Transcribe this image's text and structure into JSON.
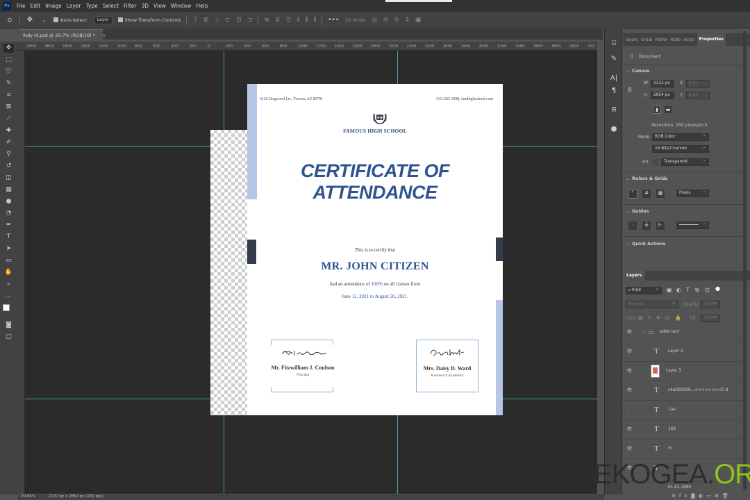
{
  "app": {
    "menu": [
      "File",
      "Edit",
      "Image",
      "Layer",
      "Type",
      "Select",
      "Filter",
      "3D",
      "View",
      "Window",
      "Help"
    ],
    "ps_logo": "Ps"
  },
  "options_bar": {
    "auto_select_label": "Auto-Select:",
    "auto_select_value": "Layer",
    "show_transform_label": "Show Transform Controls",
    "mode_3d_label": "3D Mode:",
    "more": "•••"
  },
  "document_tab": {
    "title": "Italy id.psd @ 20.7% (RGB/16) *",
    "close": "×"
  },
  "ruler": {
    "top_ticks": [
      "2000",
      "1800",
      "1600",
      "1400",
      "1200",
      "1000",
      "800",
      "600",
      "400",
      "200",
      "0",
      "200",
      "400",
      "600",
      "800",
      "1000",
      "1200",
      "1400",
      "1600",
      "1800",
      "2000",
      "2200",
      "2400",
      "2600",
      "2800",
      "3000",
      "3200",
      "3400",
      "3600",
      "3800",
      "4000",
      "420"
    ]
  },
  "certificate": {
    "address": "3126 Dogwood Ln., Tucson, AZ 85701",
    "contact": "533-283-3398, famhighschool.com",
    "crest_text": "FH",
    "school_name": "FAMOUS HIGH SCHOOL",
    "title_line1": "CERTIFICATE OF",
    "title_line2": "ATTENDANCE",
    "certify_text": "This is to certify that",
    "recipient": "MR. JOHN CITIZEN",
    "attendance_prefix": "had an attendance of",
    "attendance_pct": "100%",
    "attendance_suffix": "on all classes from",
    "dates": "June 12, 2021 to August 20, 2021.",
    "signer_left_name": "Mr. Fitzwilliam J. Coulson",
    "signer_left_role": "Principal",
    "signer_right_name": "Mrs. Daisy D. Ward",
    "signer_right_role": "President of Academics",
    "colors": {
      "accent": "#2e5490",
      "stripe_light": "#b7c6e6",
      "stripe_dark": "#343c4c"
    }
  },
  "right_panel": {
    "tabs": [
      "Swatc",
      "Gradi",
      "Patter",
      "Histo",
      "Actio",
      "Properties"
    ],
    "document_label": "Document",
    "canvas_section": "Canvas",
    "w_label": "W",
    "w_value": "2232 px",
    "x_label": "X",
    "x_value": "0 px",
    "h_label": "H",
    "h_value": "2854 px",
    "y_label": "Y",
    "y_value": "0 px",
    "resolution": "Resolution: 250 pixels/inch",
    "mode_label": "Mode",
    "mode_value": "RGB Color",
    "depth_value": "16 Bits/Channel",
    "fill_label": "Fill",
    "fill_value": "Transparent",
    "rulers_section": "Rulers & Grids",
    "rulers_unit": "Pixels",
    "guides_section": "Guides",
    "quick_actions_section": "Quick Actions"
  },
  "layers_panel": {
    "tab": "Layers",
    "kind_label": "Kind",
    "blend_mode": "Normal",
    "opacity_label": "Opacity:",
    "opacity_value": "100%",
    "lock_label": "Lock:",
    "fill_label": "Fill:",
    "fill_value": "100%",
    "rows": [
      {
        "name": "edite text",
        "kind": "group"
      },
      {
        "name": "Layer 2",
        "kind": "text"
      },
      {
        "name": "Layer 3",
        "kind": "image"
      },
      {
        "name": "c4a000000...<<<<<<<<0 d",
        "kind": "text"
      },
      {
        "name": "1aa",
        "kind": "text"
      },
      {
        "name": "169",
        "kind": "text"
      },
      {
        "name": "m",
        "kind": "text"
      },
      {
        "name": "01.01.1990",
        "kind": "text"
      }
    ]
  },
  "status_bar": {
    "zoom": "20.66%",
    "doc_info": "2232 px x 2854 px (250 ppi)"
  },
  "watermark": {
    "part1": "EKOGEA.",
    "part2": "ORG"
  }
}
